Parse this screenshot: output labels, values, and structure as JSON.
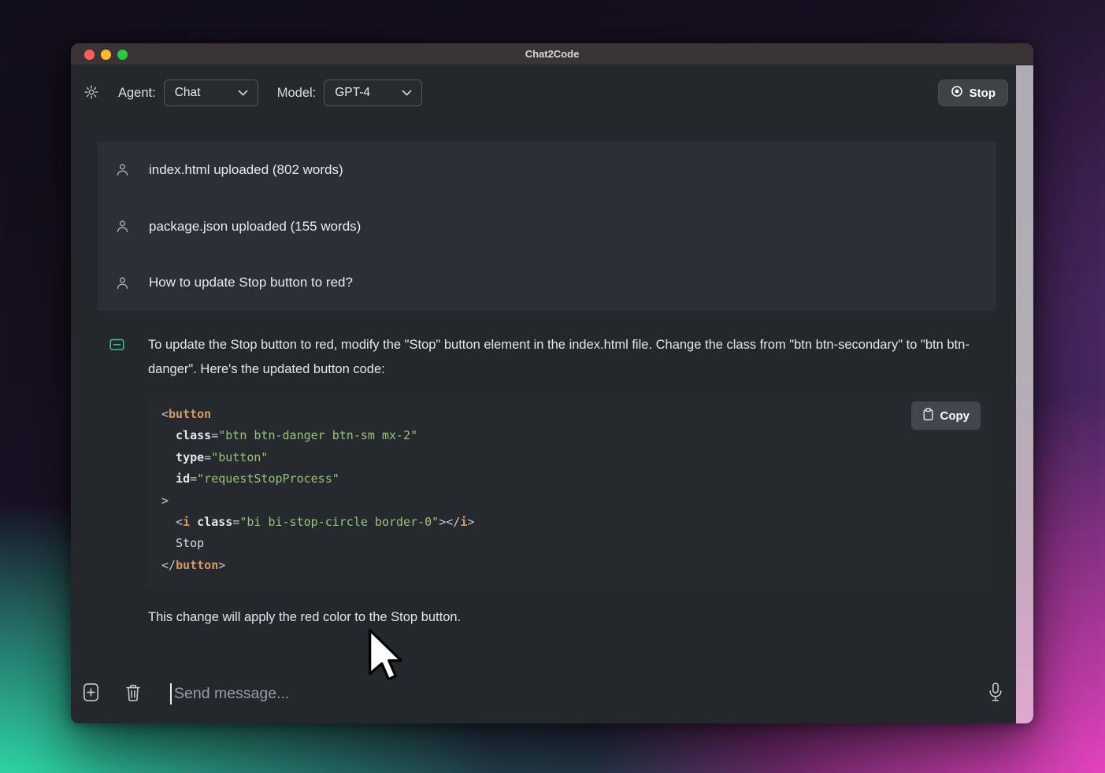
{
  "window": {
    "title": "Chat2Code"
  },
  "toolbar": {
    "agent_label": "Agent:",
    "agent_value": "Chat",
    "model_label": "Model:",
    "model_value": "GPT-4",
    "stop_label": "Stop"
  },
  "chat": {
    "user_messages": [
      "index.html uploaded (802 words)",
      "package.json uploaded (155 words)",
      "How to update Stop button to red?"
    ],
    "assistant": {
      "intro": "To update the Stop button to red, modify the \"Stop\" button element in the index.html file. Change the class from \"btn btn-secondary\" to \"btn btn-danger\". Here's the updated button code:",
      "copy_label": "Copy",
      "code_lines": [
        [
          {
            "t": "p",
            "v": "<"
          },
          {
            "t": "t",
            "v": "button"
          }
        ],
        [
          {
            "t": "a",
            "v": "  class"
          },
          {
            "t": "p",
            "v": "="
          },
          {
            "t": "s",
            "v": "\"btn btn-danger btn-sm mx-2\""
          }
        ],
        [
          {
            "t": "a",
            "v": "  type"
          },
          {
            "t": "p",
            "v": "="
          },
          {
            "t": "s",
            "v": "\"button\""
          }
        ],
        [
          {
            "t": "a",
            "v": "  id"
          },
          {
            "t": "p",
            "v": "="
          },
          {
            "t": "s",
            "v": "\"requestStopProcess\""
          }
        ],
        [
          {
            "t": "p",
            "v": ">"
          }
        ],
        [
          {
            "t": "p",
            "v": "  <"
          },
          {
            "t": "t",
            "v": "i"
          },
          {
            "t": "a",
            "v": " class"
          },
          {
            "t": "p",
            "v": "="
          },
          {
            "t": "s",
            "v": "\"bi bi-stop-circle border-0\""
          },
          {
            "t": "p",
            "v": "></"
          },
          {
            "t": "t",
            "v": "i"
          },
          {
            "t": "p",
            "v": ">"
          }
        ],
        [
          {
            "t": "x",
            "v": "  Stop"
          }
        ],
        [
          {
            "t": "p",
            "v": "</"
          },
          {
            "t": "t",
            "v": "button"
          },
          {
            "t": "p",
            "v": ">"
          }
        ]
      ],
      "outro": "This change will apply the red color to the Stop button."
    }
  },
  "composer": {
    "placeholder": "Send message..."
  },
  "colors": {
    "assistant_icon_green": "#34c98c",
    "code_tag_orange": "#d19a66",
    "code_string_green": "#98c379",
    "traffic_red": "#ff5f57",
    "traffic_yellow": "#fdbc2f",
    "traffic_green": "#28c840",
    "window_bg": "#24282c",
    "panel_bg": "#2b3036",
    "code_bg": "#26292d"
  }
}
